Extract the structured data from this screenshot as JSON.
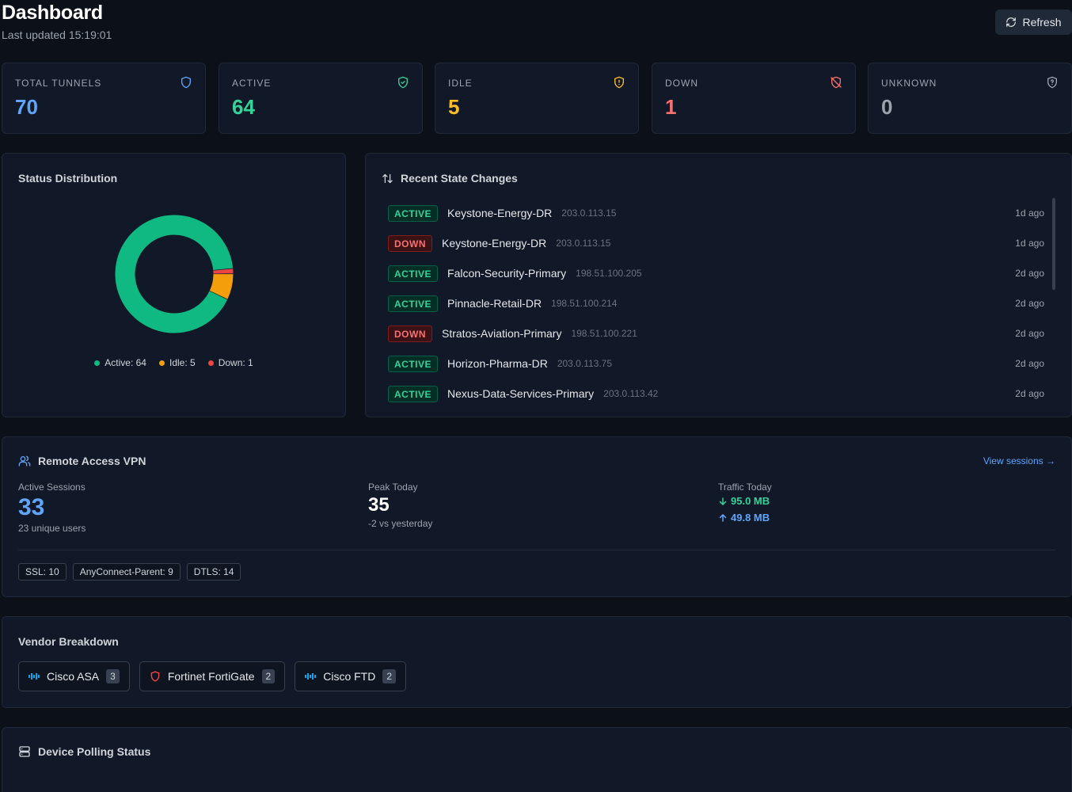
{
  "header": {
    "title": "Dashboard",
    "last_updated": "Last updated 15:19:01",
    "refresh_label": "Refresh"
  },
  "stats": [
    {
      "label": "TOTAL TUNNELS",
      "value": "70",
      "color": "#60a5fa",
      "icon": "shield-icon"
    },
    {
      "label": "ACTIVE",
      "value": "64",
      "color": "#34d399",
      "icon": "shield-check-icon"
    },
    {
      "label": "IDLE",
      "value": "5",
      "color": "#fbbf24",
      "icon": "shield-alert-icon"
    },
    {
      "label": "DOWN",
      "value": "1",
      "color": "#f87171",
      "icon": "shield-off-icon"
    },
    {
      "label": "UNKNOWN",
      "value": "0",
      "color": "#9ca3af",
      "icon": "shield-question-icon"
    }
  ],
  "status_distribution": {
    "title": "Status Distribution",
    "chart_data": {
      "type": "pie",
      "categories": [
        "Active",
        "Idle",
        "Down"
      ],
      "values": [
        64,
        5,
        1
      ],
      "colors": [
        "#10b981",
        "#f59e0b",
        "#ef4444"
      ]
    },
    "legend": [
      "Active: 64",
      "Idle: 5",
      "Down: 1"
    ]
  },
  "recent_changes": {
    "title": "Recent State Changes",
    "items": [
      {
        "status": "ACTIVE",
        "name": "Keystone-Energy-DR",
        "ip": "203.0.113.15",
        "time": "1d ago"
      },
      {
        "status": "DOWN",
        "name": "Keystone-Energy-DR",
        "ip": "203.0.113.15",
        "time": "1d ago"
      },
      {
        "status": "ACTIVE",
        "name": "Falcon-Security-Primary",
        "ip": "198.51.100.205",
        "time": "2d ago"
      },
      {
        "status": "ACTIVE",
        "name": "Pinnacle-Retail-DR",
        "ip": "198.51.100.214",
        "time": "2d ago"
      },
      {
        "status": "DOWN",
        "name": "Stratos-Aviation-Primary",
        "ip": "198.51.100.221",
        "time": "2d ago"
      },
      {
        "status": "ACTIVE",
        "name": "Horizon-Pharma-DR",
        "ip": "203.0.113.75",
        "time": "2d ago"
      },
      {
        "status": "ACTIVE",
        "name": "Nexus-Data-Services-Primary",
        "ip": "203.0.113.42",
        "time": "2d ago"
      }
    ]
  },
  "vpn": {
    "title": "Remote Access VPN",
    "view_sessions": "View sessions →",
    "active_sessions_label": "Active Sessions",
    "active_sessions": "33",
    "unique_users": "23 unique users",
    "peak_label": "Peak Today",
    "peak_value": "35",
    "peak_delta": "-2 vs yesterday",
    "traffic_label": "Traffic Today",
    "traffic_down": "95.0 MB",
    "traffic_up": "49.8 MB",
    "tags": [
      "SSL: 10",
      "AnyConnect-Parent: 9",
      "DTLS: 14"
    ]
  },
  "vendors": {
    "title": "Vendor Breakdown",
    "items": [
      {
        "name": "Cisco ASA",
        "count": "3",
        "icon": "cisco-icon"
      },
      {
        "name": "Fortinet FortiGate",
        "count": "2",
        "icon": "fortinet-icon"
      },
      {
        "name": "Cisco FTD",
        "count": "2",
        "icon": "cisco-icon"
      }
    ]
  },
  "polling": {
    "title": "Device Polling Status"
  }
}
